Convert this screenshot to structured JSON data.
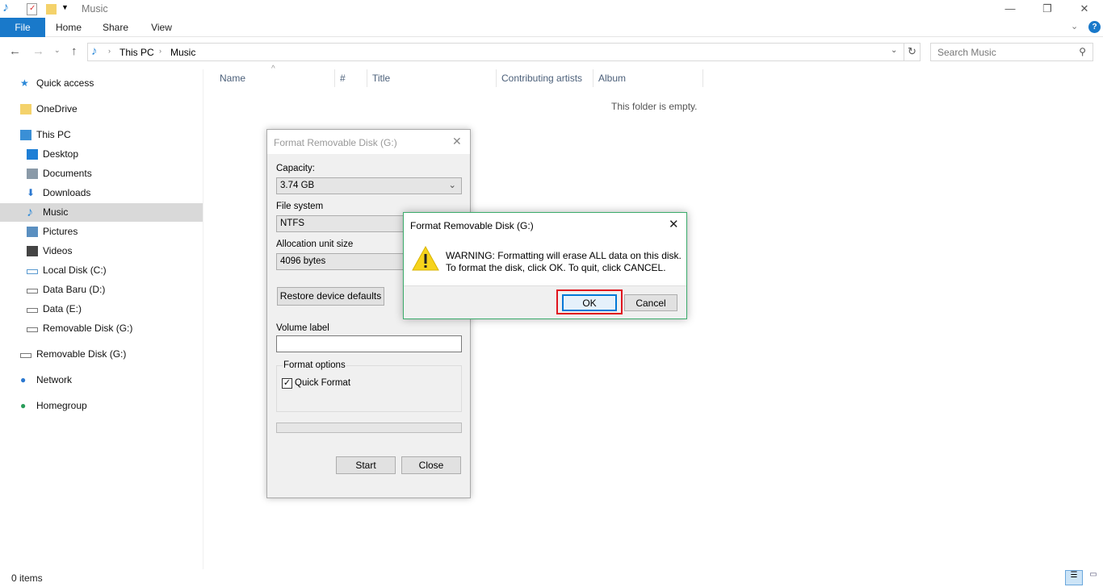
{
  "window": {
    "title": "Music",
    "minimize": "—",
    "restore": "❐",
    "close": "✕"
  },
  "ribbon": {
    "tabs": [
      "File",
      "Home",
      "Share",
      "View"
    ]
  },
  "address": {
    "path": [
      "This PC",
      "Music"
    ],
    "search_placeholder": "Search Music"
  },
  "sidebar": {
    "items": [
      {
        "label": "Quick access",
        "icon": "star-icon",
        "color": "#2b88d8"
      },
      {
        "label": "OneDrive",
        "icon": "folder-icon",
        "color": "#f4d26b"
      },
      {
        "label": "This PC",
        "icon": "computer-icon",
        "color": "#3a8fd6"
      },
      {
        "label": "Desktop",
        "icon": "desktop-icon",
        "color": "#1e7fd6"
      },
      {
        "label": "Documents",
        "icon": "documents-icon",
        "color": "#8a9aa8"
      },
      {
        "label": "Downloads",
        "icon": "downloads-icon",
        "color": "#2b78d0"
      },
      {
        "label": "Music",
        "icon": "music-icon",
        "color": "#2b88d8"
      },
      {
        "label": "Pictures",
        "icon": "pictures-icon",
        "color": "#5a8fc0"
      },
      {
        "label": "Videos",
        "icon": "videos-icon",
        "color": "#444"
      },
      {
        "label": "Local Disk (C:)",
        "icon": "disk-icon",
        "color": "#5a9ad0"
      },
      {
        "label": "Data Baru (D:)",
        "icon": "disk-icon",
        "color": "#777"
      },
      {
        "label": "Data  (E:)",
        "icon": "disk-icon",
        "color": "#777"
      },
      {
        "label": "Removable Disk (G:)",
        "icon": "removable-disk-icon",
        "color": "#777"
      },
      {
        "label": "Removable Disk (G:)",
        "icon": "removable-disk-icon",
        "color": "#777"
      },
      {
        "label": "Network",
        "icon": "network-icon",
        "color": "#2b78d0"
      },
      {
        "label": "Homegroup",
        "icon": "homegroup-icon",
        "color": "#2a9d5a"
      }
    ],
    "selected": "Music"
  },
  "columns": [
    "Name",
    "#",
    "Title",
    "Contributing artists",
    "Album"
  ],
  "empty_text": "This folder is empty.",
  "status": {
    "items": "0 items"
  },
  "format_dialog": {
    "title": "Format Removable Disk (G:)",
    "capacity_label": "Capacity:",
    "capacity": "3.74 GB",
    "fs_label": "File system",
    "fs": "NTFS",
    "alloc_label": "Allocation unit size",
    "alloc": "4096 bytes",
    "restore": "Restore device defaults",
    "volume_label": "Volume label",
    "volume_value": "",
    "options_label": "Format options",
    "quick_format": "Quick Format",
    "quick_checked": true,
    "progress": 0,
    "start": "Start",
    "close": "Close"
  },
  "warning_dialog": {
    "title": "Format Removable Disk (G:)",
    "line1": "WARNING: Formatting will erase ALL data on this disk.",
    "line2": "To format the disk, click OK. To quit, click CANCEL.",
    "ok": "OK",
    "cancel": "Cancel",
    "highlight_color": "#e0141e"
  }
}
